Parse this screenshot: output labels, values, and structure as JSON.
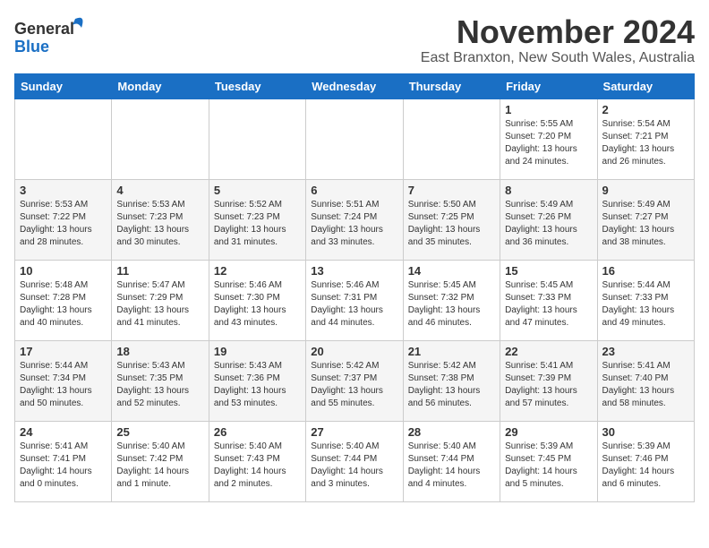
{
  "header": {
    "logo_general": "General",
    "logo_blue": "Blue",
    "month": "November 2024",
    "location": "East Branxton, New South Wales, Australia"
  },
  "weekdays": [
    "Sunday",
    "Monday",
    "Tuesday",
    "Wednesday",
    "Thursday",
    "Friday",
    "Saturday"
  ],
  "weeks": [
    [
      {
        "day": "",
        "info": ""
      },
      {
        "day": "",
        "info": ""
      },
      {
        "day": "",
        "info": ""
      },
      {
        "day": "",
        "info": ""
      },
      {
        "day": "",
        "info": ""
      },
      {
        "day": "1",
        "info": "Sunrise: 5:55 AM\nSunset: 7:20 PM\nDaylight: 13 hours\nand 24 minutes."
      },
      {
        "day": "2",
        "info": "Sunrise: 5:54 AM\nSunset: 7:21 PM\nDaylight: 13 hours\nand 26 minutes."
      }
    ],
    [
      {
        "day": "3",
        "info": "Sunrise: 5:53 AM\nSunset: 7:22 PM\nDaylight: 13 hours\nand 28 minutes."
      },
      {
        "day": "4",
        "info": "Sunrise: 5:53 AM\nSunset: 7:23 PM\nDaylight: 13 hours\nand 30 minutes."
      },
      {
        "day": "5",
        "info": "Sunrise: 5:52 AM\nSunset: 7:23 PM\nDaylight: 13 hours\nand 31 minutes."
      },
      {
        "day": "6",
        "info": "Sunrise: 5:51 AM\nSunset: 7:24 PM\nDaylight: 13 hours\nand 33 minutes."
      },
      {
        "day": "7",
        "info": "Sunrise: 5:50 AM\nSunset: 7:25 PM\nDaylight: 13 hours\nand 35 minutes."
      },
      {
        "day": "8",
        "info": "Sunrise: 5:49 AM\nSunset: 7:26 PM\nDaylight: 13 hours\nand 36 minutes."
      },
      {
        "day": "9",
        "info": "Sunrise: 5:49 AM\nSunset: 7:27 PM\nDaylight: 13 hours\nand 38 minutes."
      }
    ],
    [
      {
        "day": "10",
        "info": "Sunrise: 5:48 AM\nSunset: 7:28 PM\nDaylight: 13 hours\nand 40 minutes."
      },
      {
        "day": "11",
        "info": "Sunrise: 5:47 AM\nSunset: 7:29 PM\nDaylight: 13 hours\nand 41 minutes."
      },
      {
        "day": "12",
        "info": "Sunrise: 5:46 AM\nSunset: 7:30 PM\nDaylight: 13 hours\nand 43 minutes."
      },
      {
        "day": "13",
        "info": "Sunrise: 5:46 AM\nSunset: 7:31 PM\nDaylight: 13 hours\nand 44 minutes."
      },
      {
        "day": "14",
        "info": "Sunrise: 5:45 AM\nSunset: 7:32 PM\nDaylight: 13 hours\nand 46 minutes."
      },
      {
        "day": "15",
        "info": "Sunrise: 5:45 AM\nSunset: 7:33 PM\nDaylight: 13 hours\nand 47 minutes."
      },
      {
        "day": "16",
        "info": "Sunrise: 5:44 AM\nSunset: 7:33 PM\nDaylight: 13 hours\nand 49 minutes."
      }
    ],
    [
      {
        "day": "17",
        "info": "Sunrise: 5:44 AM\nSunset: 7:34 PM\nDaylight: 13 hours\nand 50 minutes."
      },
      {
        "day": "18",
        "info": "Sunrise: 5:43 AM\nSunset: 7:35 PM\nDaylight: 13 hours\nand 52 minutes."
      },
      {
        "day": "19",
        "info": "Sunrise: 5:43 AM\nSunset: 7:36 PM\nDaylight: 13 hours\nand 53 minutes."
      },
      {
        "day": "20",
        "info": "Sunrise: 5:42 AM\nSunset: 7:37 PM\nDaylight: 13 hours\nand 55 minutes."
      },
      {
        "day": "21",
        "info": "Sunrise: 5:42 AM\nSunset: 7:38 PM\nDaylight: 13 hours\nand 56 minutes."
      },
      {
        "day": "22",
        "info": "Sunrise: 5:41 AM\nSunset: 7:39 PM\nDaylight: 13 hours\nand 57 minutes."
      },
      {
        "day": "23",
        "info": "Sunrise: 5:41 AM\nSunset: 7:40 PM\nDaylight: 13 hours\nand 58 minutes."
      }
    ],
    [
      {
        "day": "24",
        "info": "Sunrise: 5:41 AM\nSunset: 7:41 PM\nDaylight: 14 hours\nand 0 minutes."
      },
      {
        "day": "25",
        "info": "Sunrise: 5:40 AM\nSunset: 7:42 PM\nDaylight: 14 hours\nand 1 minute."
      },
      {
        "day": "26",
        "info": "Sunrise: 5:40 AM\nSunset: 7:43 PM\nDaylight: 14 hours\nand 2 minutes."
      },
      {
        "day": "27",
        "info": "Sunrise: 5:40 AM\nSunset: 7:44 PM\nDaylight: 14 hours\nand 3 minutes."
      },
      {
        "day": "28",
        "info": "Sunrise: 5:40 AM\nSunset: 7:44 PM\nDaylight: 14 hours\nand 4 minutes."
      },
      {
        "day": "29",
        "info": "Sunrise: 5:39 AM\nSunset: 7:45 PM\nDaylight: 14 hours\nand 5 minutes."
      },
      {
        "day": "30",
        "info": "Sunrise: 5:39 AM\nSunset: 7:46 PM\nDaylight: 14 hours\nand 6 minutes."
      }
    ]
  ]
}
